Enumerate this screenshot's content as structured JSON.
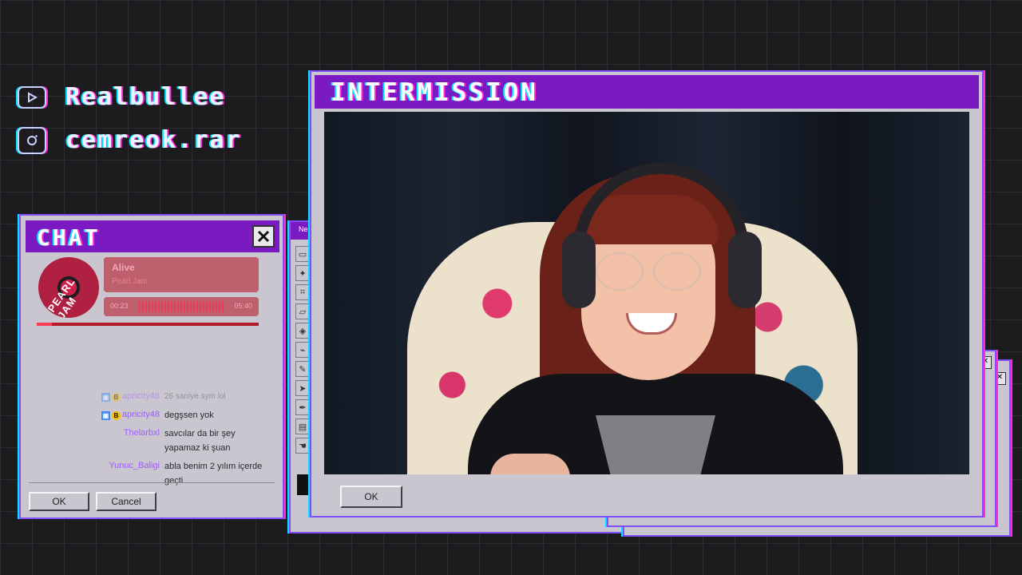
{
  "socials": [
    {
      "icon": "youtube-icon",
      "handle": "Realbullee"
    },
    {
      "icon": "instagram-icon",
      "handle": "cemreok.rar"
    }
  ],
  "chat_window": {
    "title": "CHAT",
    "now_playing": {
      "album_label": "PEARL JAM",
      "track": "Alive",
      "artist": "Pearl Jam",
      "elapsed": "00:23",
      "total": "05:40",
      "progress_fraction": 0.07
    },
    "messages": [
      {
        "user": "apricity48",
        "text": "26 saniye sym lol",
        "faded": true,
        "badges": [
          "sub",
          "bits"
        ]
      },
      {
        "user": "apricity48",
        "text": "degşsen yok",
        "faded": false,
        "badges": [
          "sub",
          "bits"
        ]
      },
      {
        "user": "Thelarbxl",
        "text": "savcılar da bir şey yapamaz ki şuan",
        "faded": false,
        "badges": []
      },
      {
        "user": "Yunuc_Baligi",
        "text": "abla benim 2 yılım içerde geçti",
        "faded": false,
        "badges": []
      }
    ],
    "ok_label": "OK",
    "cancel_label": "Cancel"
  },
  "paint_window": {
    "title": "Ne",
    "tools": [
      "select-rect",
      "select-free",
      "crop",
      "eraser",
      "fill",
      "picker",
      "brush",
      "pointer",
      "pen",
      "text",
      "hand"
    ]
  },
  "main_window": {
    "title": "INTERMISSION",
    "ok_label": "OK"
  },
  "colors": {
    "titlebar": "#7b19c2",
    "window_bg": "#c9c6cf",
    "border": "#7d4fff",
    "glitch_cyan": "#00e5ff",
    "glitch_magenta": "#ff2bd6",
    "background": "#1c1c1e"
  }
}
